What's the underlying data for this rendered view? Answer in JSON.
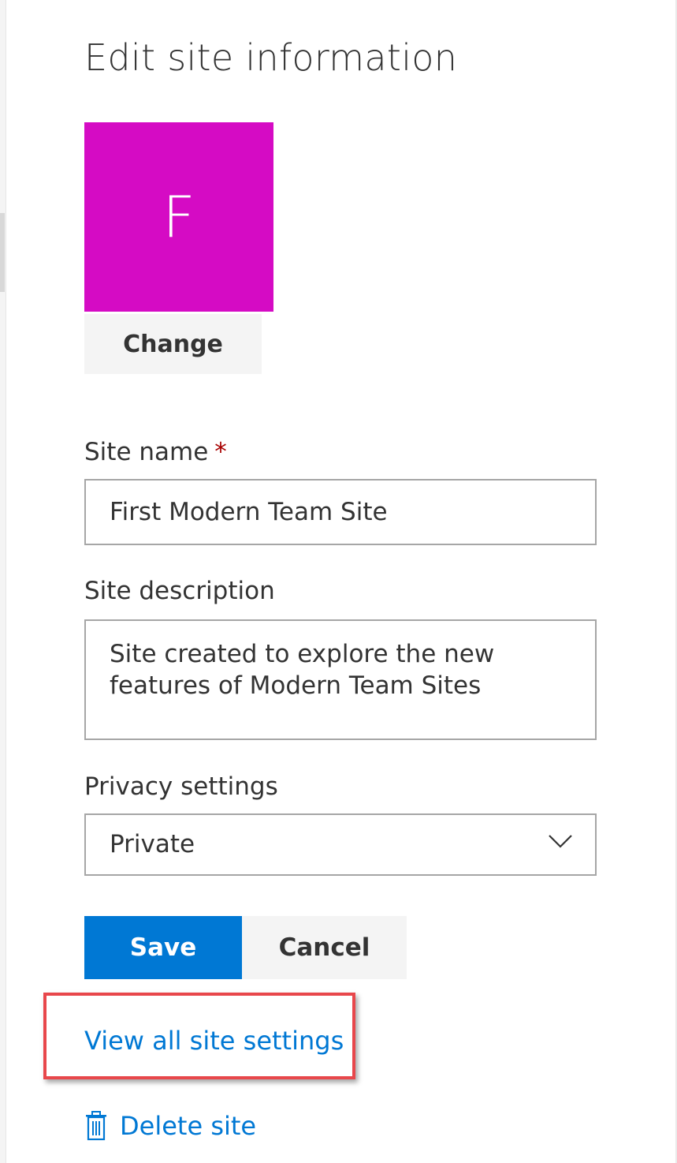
{
  "panel": {
    "title": "Edit site information"
  },
  "logo": {
    "letter": "F",
    "color": "#d50bc4",
    "change_label": "Change"
  },
  "site_name": {
    "label": "Site name",
    "required_mark": "*",
    "value": "First Modern Team Site"
  },
  "site_description": {
    "label": "Site description",
    "value": "Site created to explore the new\nfeatures of Modern Team Sites"
  },
  "privacy": {
    "label": "Privacy settings",
    "selected": "Private",
    "icon": "chevron-down-icon"
  },
  "actions": {
    "save_label": "Save",
    "cancel_label": "Cancel"
  },
  "links": {
    "view_all_settings": "View all site settings",
    "delete_site": "Delete site",
    "delete_icon": "trash-icon"
  },
  "colors": {
    "accent": "#0078d4",
    "highlight_border": "#e8474b",
    "required": "#a80000"
  }
}
